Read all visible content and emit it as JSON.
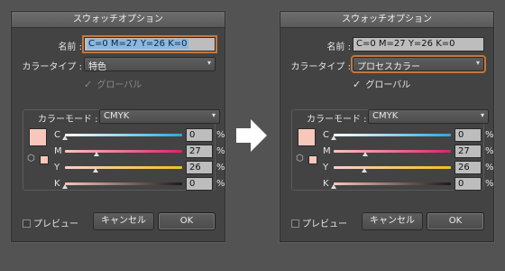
{
  "left_dialog": {
    "title": "スウォッチオプション",
    "name_label": "名前 :",
    "name_value": "C=0 M=27 Y=26 K=0",
    "color_type_label": "カラータイプ :",
    "color_type_value": "特色",
    "global_label": "グローバル",
    "color_mode_label": "カラーモード :",
    "color_mode_value": "CMYK",
    "channels": [
      {
        "label": "C",
        "value": "0",
        "unit": "%"
      },
      {
        "label": "M",
        "value": "27",
        "unit": "%"
      },
      {
        "label": "Y",
        "value": "26",
        "unit": "%"
      },
      {
        "label": "K",
        "value": "0",
        "unit": "%"
      }
    ],
    "preview_label": "プレビュー",
    "cancel_label": "キャンセル",
    "ok_label": "OK"
  },
  "right_dialog": {
    "title": "スウォッチオプション",
    "name_label": "名前 :",
    "name_value": "C=0 M=27 Y=26 K=0",
    "color_type_label": "カラータイプ :",
    "color_type_value": "プロセスカラー",
    "global_label": "グローバル",
    "color_mode_label": "カラーモード :",
    "color_mode_value": "CMYK",
    "channels": [
      {
        "label": "C",
        "value": "0",
        "unit": "%"
      },
      {
        "label": "M",
        "value": "27",
        "unit": "%"
      },
      {
        "label": "Y",
        "value": "26",
        "unit": "%"
      },
      {
        "label": "K",
        "value": "0",
        "unit": "%"
      }
    ],
    "preview_label": "プレビュー",
    "cancel_label": "キャンセル",
    "ok_label": "OK"
  },
  "colors": {
    "swatch": "#f7c7bb",
    "focus_ring": "#c8773a",
    "background": "#535353",
    "dialog": "#434343"
  },
  "icons": {
    "arrow": "right-arrow-icon",
    "checkmark": "checkmark-icon",
    "dropdown": "chevron-down-icon",
    "gamut": "cube-icon"
  }
}
